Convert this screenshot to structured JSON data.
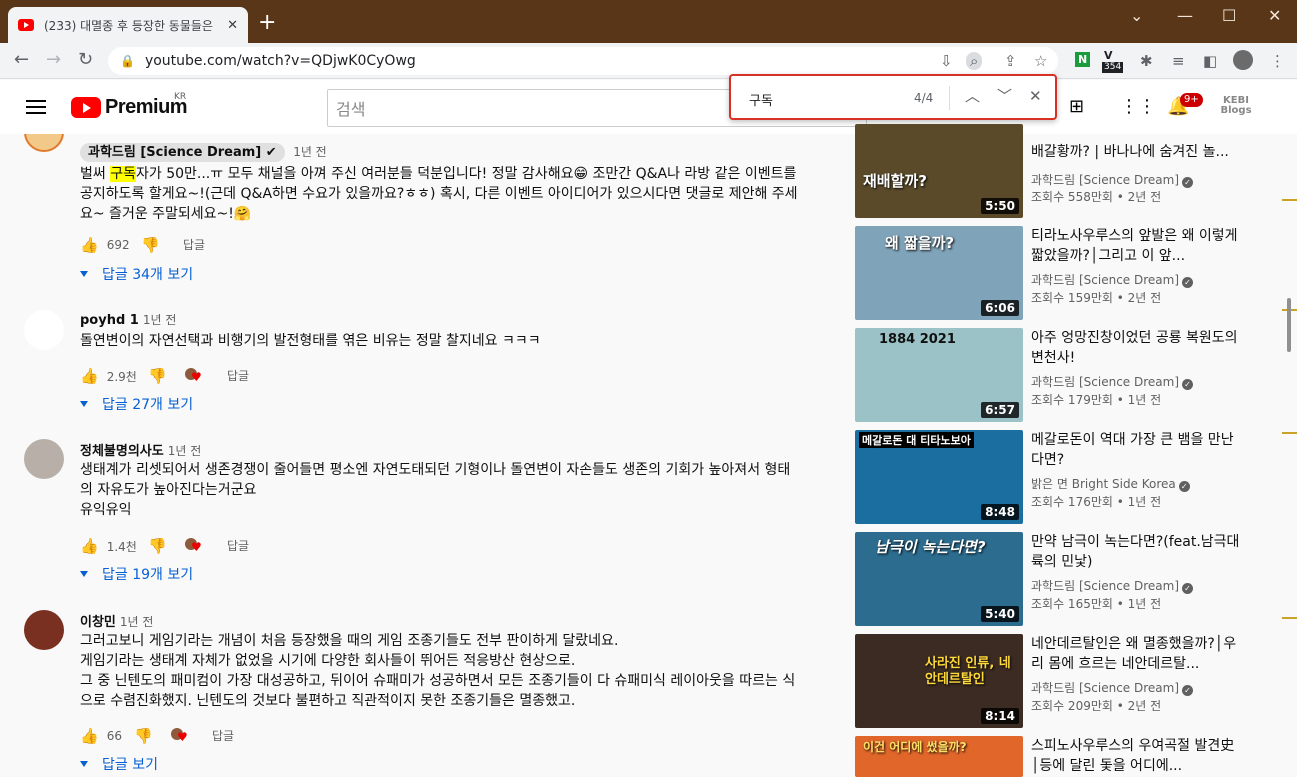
{
  "browser": {
    "tab_title": "(233) 대멸종 후 등장한 동물들은",
    "tab_close": "✕",
    "new_tab": "+",
    "url": "youtube.com/watch?v=QDjwK0CyOwg",
    "ext_badge_count": "354",
    "ext_badge_label": "V"
  },
  "youtube": {
    "logo_text": "Premium",
    "region": "KR",
    "search_placeholder": "검색",
    "notification_count": "9+",
    "channel_logo_text": "KEBI Blogs"
  },
  "find_bar": {
    "query": "구독",
    "count": "4/4"
  },
  "comments": [
    {
      "author": "과학드림 [Science Dream] ✔",
      "time": "1년 전",
      "text_before": "벌써 ",
      "text_highlight": "구독",
      "text_after": "자가 50만...ㅠ 모두 채널을 아껴 주신 여러분들 덕분입니다! 정말 감사해요😁 조만간 Q&A나 라방 같은 이벤트를 공지하도록 할게요~!(근데 Q&A하면 수요가 있을까요?ㅎㅎ) 혹시, 다른 이벤트 아이디어가 있으시다면 댓글로 제안해 주세요~ 즐거운 주말되세요~!🤗",
      "likes": "692",
      "reply_label": "답글",
      "replies": "답글 34개 보기"
    },
    {
      "author": "poyhd 1",
      "time": "1년 전",
      "text": "돌연변이의 자연선택과 비행기의 발전형태를 엮은 비유는 정말 찰지네요 ㅋㅋㅋ",
      "likes": "2.9천",
      "reply_label": "답글",
      "replies": "답글 27개 보기"
    },
    {
      "author": "정체불명의사도",
      "time": "1년 전",
      "text": "생태계가 리셋되어서 생존경쟁이 줄어들면 평소엔 자연도태되던 기형이나 돌연변이 자손들도 생존의 기회가 높아져서 형태의 자유도가 높아진다는거군요\n유익유익",
      "likes": "1.4천",
      "reply_label": "답글",
      "replies": "답글 19개 보기"
    },
    {
      "author": "이창민",
      "time": "1년 전",
      "text": "그러고보니 게임기라는 개념이 처음 등장했을 때의 게임 조종기들도 전부 판이하게 달랐네요.\n게임기라는 생태계 자체가 없었을 시기에 다양한 회사들이 뛰어든 적응방산 현상으로.\n그 중 닌텐도의 패미컴이 가장 대성공하고, 뒤이어 슈패미가 성공하면서 모든 조종기들이 다 슈패미식 레이아웃을 따르는 식으로 수렴진화했지. 닌텐도의 것보다 불편하고 직관적이지 못한 조종기들은 멸종했고.",
      "likes": "66",
      "reply_label": "답글",
      "replies": "답글 보기"
    }
  ],
  "sidebar": [
    {
      "title": "배갈황까? | 바나나에 숨겨진 놀...",
      "title_top": "...배갈황까? | 바나나에 숨겨진 놀",
      "channel": "과학드림 [Science Dream]",
      "meta": "조회수 558만회 • 2년 전",
      "duration": "5:50",
      "caption": "재배할까?",
      "bg": "#5a4a2a"
    },
    {
      "title": "티라노사우루스의 앞발은 왜 이렇게 짧았을까?│그리고 이 앞...",
      "channel": "과학드림 [Science Dream]",
      "meta": "조회수 159만회 • 2년 전",
      "duration": "6:06",
      "caption": "왜 짧을까?",
      "bg": "#7fa3b8"
    },
    {
      "title": "아주 엉망진창이었던 공룡 복원도의 변천사!",
      "channel": "과학드림 [Science Dream]",
      "meta": "조회수 179만회 • 1년 전",
      "duration": "6:57",
      "caption": "1884   2021",
      "bg": "#9bc3c7"
    },
    {
      "title": "메갈로돈이 역대 가장 큰 뱀을 만난다면?",
      "channel": "밝은 면 Bright Side Korea",
      "meta": "조회수 176만회 • 1년 전",
      "duration": "8:48",
      "caption": "메갈로돈 대 티타노보아",
      "bg": "#1b6fa0"
    },
    {
      "title": "만약 남극이 녹는다면?(feat.남극대륙의 민낯)",
      "channel": "과학드림 [Science Dream]",
      "meta": "조회수 165만회 • 1년 전",
      "duration": "5:40",
      "caption": "남극이 녹는다면?",
      "bg": "#2c6c8f"
    },
    {
      "title": "네안데르탈인은 왜 멸종했을까?│우리 몸에 흐르는 네안데르탈...",
      "channel": "과학드림 [Science Dream]",
      "meta": "조회수 209만회 • 2년 전",
      "duration": "8:14",
      "caption": "사라진 인류, 네안데르탈인",
      "bg": "#3b2b22"
    },
    {
      "title": "스피노사우루스의 우여곡절 발견史│등에 달린 돛을 어디에...",
      "channel": "",
      "meta": "",
      "duration": "",
      "caption": "이건 어디에 썼을까?",
      "bg": "#e0662a"
    }
  ],
  "colors": {
    "titlebar": "#5a3618",
    "link_blue": "#065fd4",
    "highlight": "#ffff00",
    "find_border": "#d93025"
  }
}
